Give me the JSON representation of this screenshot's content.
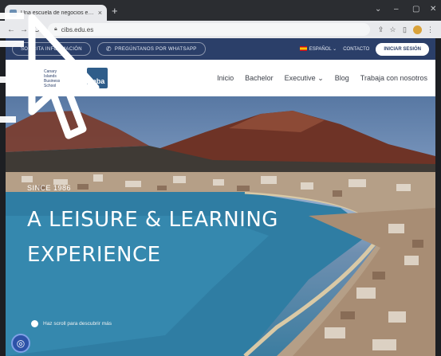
{
  "browser": {
    "tab_title": "Una escuela de negocios en el paraíso",
    "tab_close": "×",
    "new_tab": "+",
    "window_controls": [
      "⌄",
      "–",
      "▢",
      "✕"
    ],
    "nav": {
      "back": "←",
      "forward": "→",
      "reload": "C"
    },
    "url": "cibs.edu.es"
  },
  "topbar": {
    "request_info_label": "SOLICITA INFORMACIÓN",
    "whatsapp_label": "PREGÚNTANOS POR WHATSAPP",
    "language_label": "ESPAÑOL",
    "contact_label": "CONTACTO",
    "login_label": "INICIAR SESIÓN"
  },
  "nav": {
    "logo_lines": [
      "Canary",
      "Islands",
      "Business",
      "School"
    ],
    "mba_label": "mba",
    "items": [
      "Inicio",
      "Bachelor",
      "Executive",
      "Blog",
      "Trabaja con nosotros"
    ]
  },
  "hero": {
    "since": "SINCE 1986",
    "headline_line1": "A LEISURE & LEARNING",
    "headline_line2": "EXPERIENCE",
    "scroll_hint": "Haz scroll para descubrir más"
  },
  "colors": {
    "topbar_bg": "#2b3f69",
    "nav_bg": "#ffffff",
    "chrome_dark": "#2b2d31",
    "chrome_light": "#e8e9ec"
  },
  "icons": [
    "whatsapp-icon",
    "flag-spain-icon",
    "lock-icon",
    "star-icon",
    "share-icon",
    "fingerprint-icon",
    "mouse-cursor-icon"
  ]
}
